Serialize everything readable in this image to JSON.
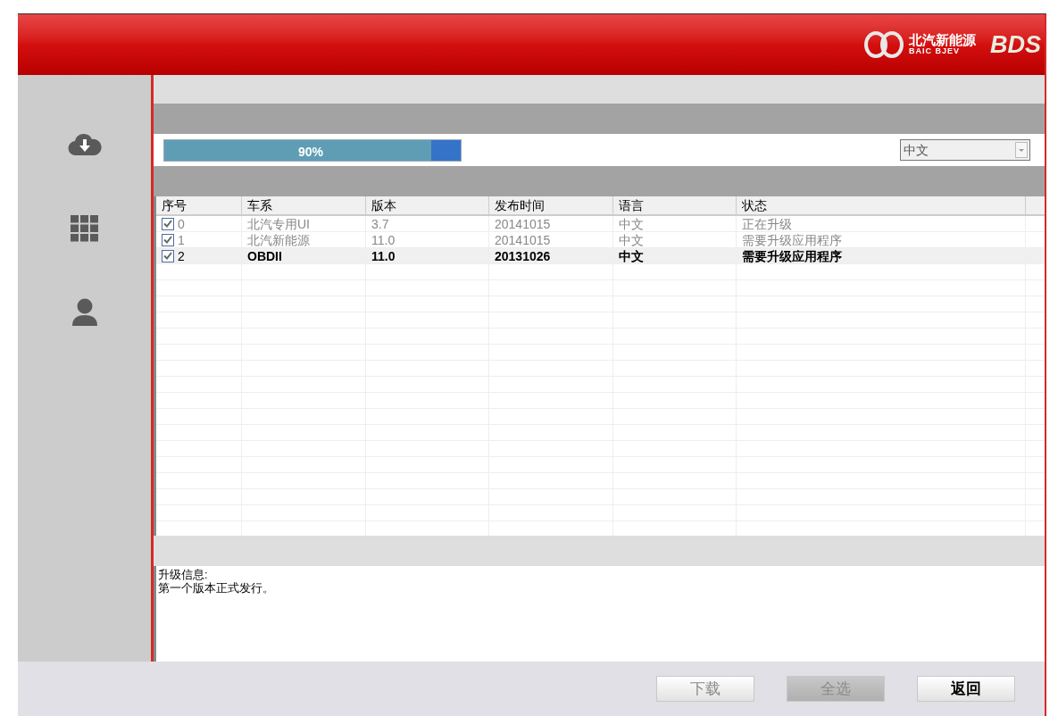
{
  "header": {
    "brand_cn": "北汽新能源",
    "brand_en": "BAIC BJEV",
    "product": "BDS"
  },
  "sidebar": {
    "items": [
      {
        "kind": "download"
      },
      {
        "kind": "apps"
      },
      {
        "kind": "user"
      }
    ]
  },
  "progress": {
    "level": 0.9,
    "reading": "90%"
  },
  "language_select": {
    "value": "中文"
  },
  "table": {
    "columns": [
      "序号",
      "车系",
      "版本",
      "发布时间",
      "语言",
      "状态"
    ],
    "rows": [
      {
        "checked": true,
        "selected": false,
        "cells": [
          "0",
          "北汽专用UI",
          "3.7",
          "20141015",
          "中文",
          "正在升级"
        ]
      },
      {
        "checked": true,
        "selected": false,
        "cells": [
          "1",
          "北汽新能源",
          "11.0",
          "20141015",
          "中文",
          "需要升级应用程序"
        ]
      },
      {
        "checked": true,
        "selected": true,
        "cells": [
          "2",
          "OBDII",
          "11.0",
          "20131026",
          "中文",
          "需要升级应用程序"
        ]
      }
    ]
  },
  "info": {
    "label": "升级信息:",
    "text": "第一个版本正式发行。"
  },
  "buttons": [
    {
      "label": "下载",
      "disabled": true,
      "pressed": false
    },
    {
      "label": "全选",
      "disabled": true,
      "pressed": true
    },
    {
      "label": "返回",
      "disabled": false,
      "pressed": false
    }
  ]
}
